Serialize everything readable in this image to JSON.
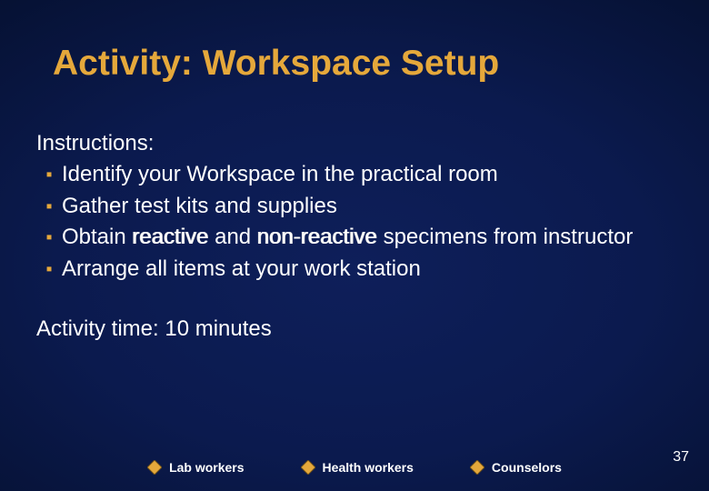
{
  "title": "Activity: Workspace Setup",
  "instructions_label": "Instructions:",
  "bullets": [
    {
      "text": "Identify your Workspace in the practical room"
    },
    {
      "text": "Gather test kits and supplies"
    },
    {
      "prefix": "Obtain ",
      "emph1": "reactive",
      "middle": " and ",
      "emph2": "non-reactive",
      "suffix": " specimens from instructor"
    },
    {
      "text": "Arrange all items at your work station"
    }
  ],
  "activity_time": "Activity time: 10 minutes",
  "legend": {
    "lab": "Lab workers",
    "health": "Health workers",
    "counselors": "Counselors"
  },
  "page_number": "37",
  "colors": {
    "accent": "#e5a83b",
    "text": "#ffffff"
  }
}
